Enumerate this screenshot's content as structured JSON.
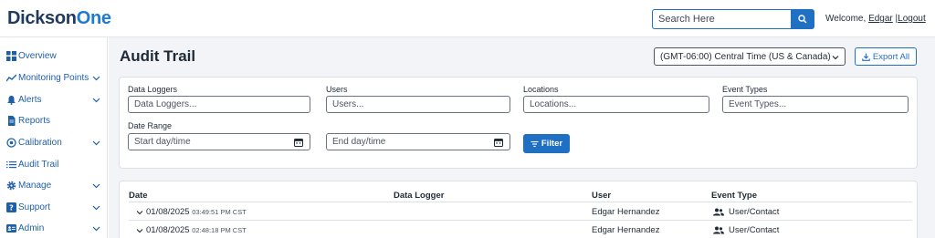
{
  "brand": {
    "logo_part1": "Dickson",
    "logo_part2": "One"
  },
  "header": {
    "search_placeholder": "Search Here",
    "welcome_prefix": "Welcome,",
    "user_name": "Edgar",
    "separator": "|",
    "logout": "Logout"
  },
  "sidebar": {
    "items": [
      {
        "label": "Overview",
        "icon": "dashboard-icon",
        "has_chevron": false
      },
      {
        "label": "Monitoring Points",
        "icon": "line-chart-icon",
        "has_chevron": true
      },
      {
        "label": "Alerts",
        "icon": "bell-icon",
        "has_chevron": true
      },
      {
        "label": "Reports",
        "icon": "document-icon",
        "has_chevron": false
      },
      {
        "label": "Calibration",
        "icon": "calibration-icon",
        "has_chevron": true
      },
      {
        "label": "Audit Trail",
        "icon": "list-icon",
        "has_chevron": false
      },
      {
        "label": "Manage",
        "icon": "gear-icon",
        "has_chevron": true
      },
      {
        "label": "Support",
        "icon": "help-icon",
        "has_chevron": true
      },
      {
        "label": "Admin",
        "icon": "admin-card-icon",
        "has_chevron": true
      }
    ]
  },
  "main": {
    "title": "Audit Trail",
    "timezone": "(GMT-06:00) Central Time (US & Canada)",
    "export_label": "Export All"
  },
  "filters": {
    "data_loggers": {
      "label": "Data Loggers",
      "placeholder": "Data Loggers..."
    },
    "users": {
      "label": "Users",
      "placeholder": "Users..."
    },
    "locations": {
      "label": "Locations",
      "placeholder": "Locations..."
    },
    "event_types": {
      "label": "Event Types",
      "placeholder": "Event Types..."
    },
    "date_range": {
      "label": "Date Range",
      "start_placeholder": "Start day/time",
      "end_placeholder": "End day/time"
    },
    "filter_button": "Filter"
  },
  "table": {
    "columns": [
      "Date",
      "Data Logger",
      "User",
      "Event Type"
    ],
    "rows": [
      {
        "date": "01/08/2025",
        "time": "03:49:51 PM CST",
        "data_logger": "",
        "user": "Edgar Hernandez",
        "event_type": "User/Contact"
      },
      {
        "date": "01/08/2025",
        "time": "02:48:18 PM CST",
        "data_logger": "",
        "user": "Edgar Hernandez",
        "event_type": "User/Contact"
      }
    ]
  },
  "colors": {
    "accent": "#1f6fc2",
    "nav_text": "#1f5fa8",
    "main_bg": "#f2f4f7"
  }
}
